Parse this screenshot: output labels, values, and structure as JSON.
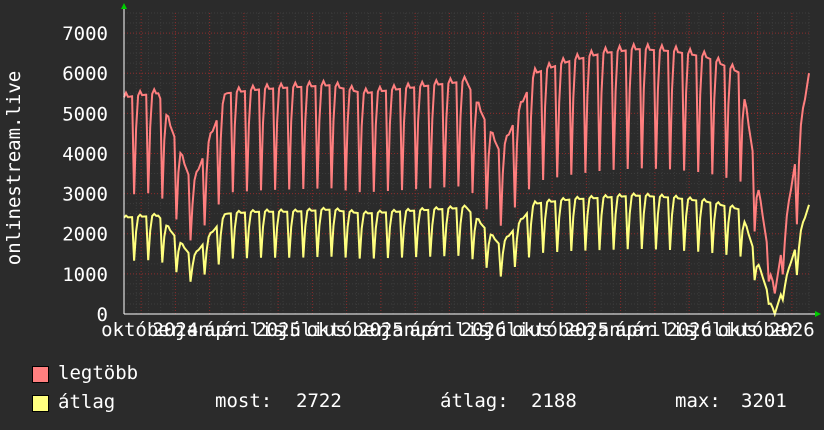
{
  "chart_data": {
    "type": "line",
    "ylabel": "onlinestream.live",
    "ylim": [
      0,
      7500
    ],
    "y_ticks": [
      0,
      1000,
      2000,
      3000,
      4000,
      5000,
      6000,
      7000
    ],
    "grid": true,
    "x_tick_labels": [
      "október",
      "2024",
      "január",
      "április",
      "2025",
      "július",
      "október",
      "2025",
      "január",
      "április",
      "2026",
      "július",
      "október",
      "2025",
      "január",
      "április",
      "2026",
      "július",
      "október",
      "2026"
    ],
    "x": [
      0,
      0.05,
      0.1,
      0.15,
      0.2,
      0.25,
      0.3,
      0.35,
      0.4,
      0.45,
      0.5,
      0.55,
      0.6,
      0.65,
      0.7,
      0.75,
      0.8,
      0.85,
      0.9,
      0.95,
      1.0
    ],
    "series": [
      {
        "name": "legtöbb",
        "color": "#ff7f7f",
        "values": [
          5400,
          5500,
          3200,
          5500,
          5600,
          5650,
          5700,
          5500,
          5600,
          5700,
          5800,
          4000,
          6000,
          6300,
          6500,
          6600,
          6550,
          6400,
          6000,
          500,
          6000
        ]
      },
      {
        "name": "átlag",
        "color": "#ffff7f",
        "values": [
          2400,
          2450,
          1400,
          2500,
          2550,
          2550,
          2600,
          2500,
          2550,
          2600,
          2650,
          1700,
          2750,
          2850,
          2900,
          2950,
          2900,
          2800,
          2600,
          0,
          2722
        ]
      }
    ]
  },
  "legend": {
    "max_label": "legtöbb",
    "avg_label": "átlag"
  },
  "stats": {
    "now_label": "most:",
    "now_value": "2722",
    "avg_label": "átlag:",
    "avg_value": "2188",
    "max_label": "max:",
    "max_value": "3201"
  },
  "colors": {
    "background": "#2b2b2b",
    "plot_background": "#2b2b2b",
    "grid_minor": "#3c3c3c",
    "grid_major": "#8b2a2a",
    "axis_arrow": "#00cc00",
    "text": "#ffffff"
  }
}
